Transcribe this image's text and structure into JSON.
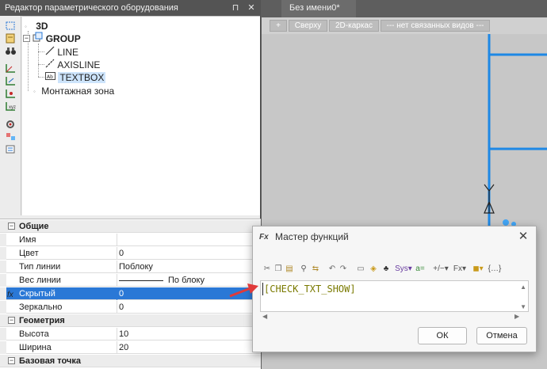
{
  "left_panel": {
    "title": "Редактор параметрического оборудования",
    "title_buttons": [
      "pin-icon",
      "close-icon"
    ]
  },
  "tree": {
    "nodes": [
      {
        "label": "3D",
        "bold": true
      },
      {
        "label": "GROUP",
        "bold": true
      },
      {
        "label": "LINE"
      },
      {
        "label": "AXISLINE"
      },
      {
        "label": "TEXTBOX",
        "selected": true
      },
      {
        "label": "Монтажная зона"
      }
    ]
  },
  "properties": {
    "rows": [
      {
        "type": "category",
        "name": "Общие",
        "expander": "⊟"
      },
      {
        "name": "Имя",
        "value": ""
      },
      {
        "name": "Цвет",
        "value": "0"
      },
      {
        "name": "Тип линии",
        "value": "Поблоку"
      },
      {
        "name": "Вес линии",
        "value": "По блоку"
      },
      {
        "name": "Скрытый",
        "value": "0",
        "selected": true,
        "fx": "fx"
      },
      {
        "name": "Зеркально",
        "value": "0"
      },
      {
        "type": "category",
        "name": "Геометрия",
        "expander": "⊟"
      },
      {
        "name": "Высота",
        "value": "10"
      },
      {
        "name": "Ширина",
        "value": "20"
      },
      {
        "type": "category",
        "name": "Базовая точка",
        "expander": "⊟"
      }
    ]
  },
  "document": {
    "tab": "Без имени0*",
    "toolbar": [
      "+",
      "Сверху",
      "2D-каркас",
      "--- нет связанных видов ---"
    ],
    "colors": {
      "drawing_line": "#1e88e5",
      "canvas": "#c7c7c7"
    }
  },
  "dialog": {
    "title": "Мастер функций",
    "icon_text": "Fx",
    "expression": "[CHECK_TXT_SHOW]",
    "buttons": {
      "ok": "ОК",
      "cancel": "Отмена"
    },
    "toolbar_icons": [
      "cut-icon",
      "copy-icon",
      "paste-icon",
      "find-icon",
      "replace-icon",
      "undo-icon",
      "redo-icon",
      "bracket-icon",
      "variable-icon",
      "tree-icon",
      "sys-icon",
      "operators-icon",
      "text-icon",
      "functions-icon",
      "constants-icon",
      "braces-icon"
    ]
  },
  "accent_colors": {
    "selection": "#2a78d6",
    "arrow": "#e03a3a"
  }
}
